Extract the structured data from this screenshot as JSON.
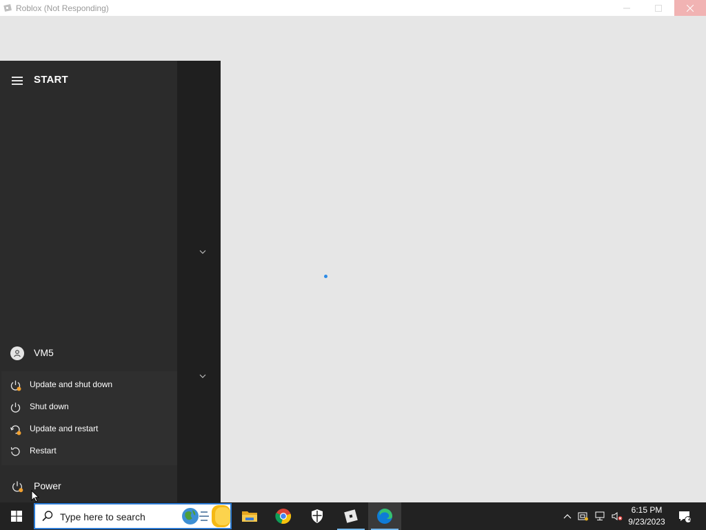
{
  "window": {
    "title": "Roblox (Not Responding)",
    "controls": {
      "minimize": "—",
      "maximize": "☐",
      "close": "✕"
    }
  },
  "start_menu": {
    "title": "START",
    "user": {
      "name": "VM5"
    },
    "power_options": [
      {
        "label": "Update and shut down",
        "icon": "power-update-icon"
      },
      {
        "label": "Shut down",
        "icon": "power-icon"
      },
      {
        "label": "Update and restart",
        "icon": "restart-update-icon"
      },
      {
        "label": "Restart",
        "icon": "restart-icon"
      }
    ],
    "power_label": "Power"
  },
  "taskbar": {
    "search_placeholder": "Type here to search",
    "apps": [
      {
        "name": "File Explorer",
        "icon": "file-explorer-icon"
      },
      {
        "name": "Google Chrome",
        "icon": "chrome-icon"
      },
      {
        "name": "Windows Security",
        "icon": "shield-icon"
      },
      {
        "name": "Roblox",
        "icon": "roblox-icon"
      },
      {
        "name": "Microsoft Edge",
        "icon": "edge-icon"
      }
    ],
    "clock": {
      "time": "6:15 PM",
      "date": "9/23/2023"
    },
    "notification_count": "2"
  },
  "colors": {
    "accent": "#2b7bd6",
    "start_bg": "#2b2b2b",
    "taskbar_bg": "#222222",
    "update_badge": "#f0a030"
  }
}
